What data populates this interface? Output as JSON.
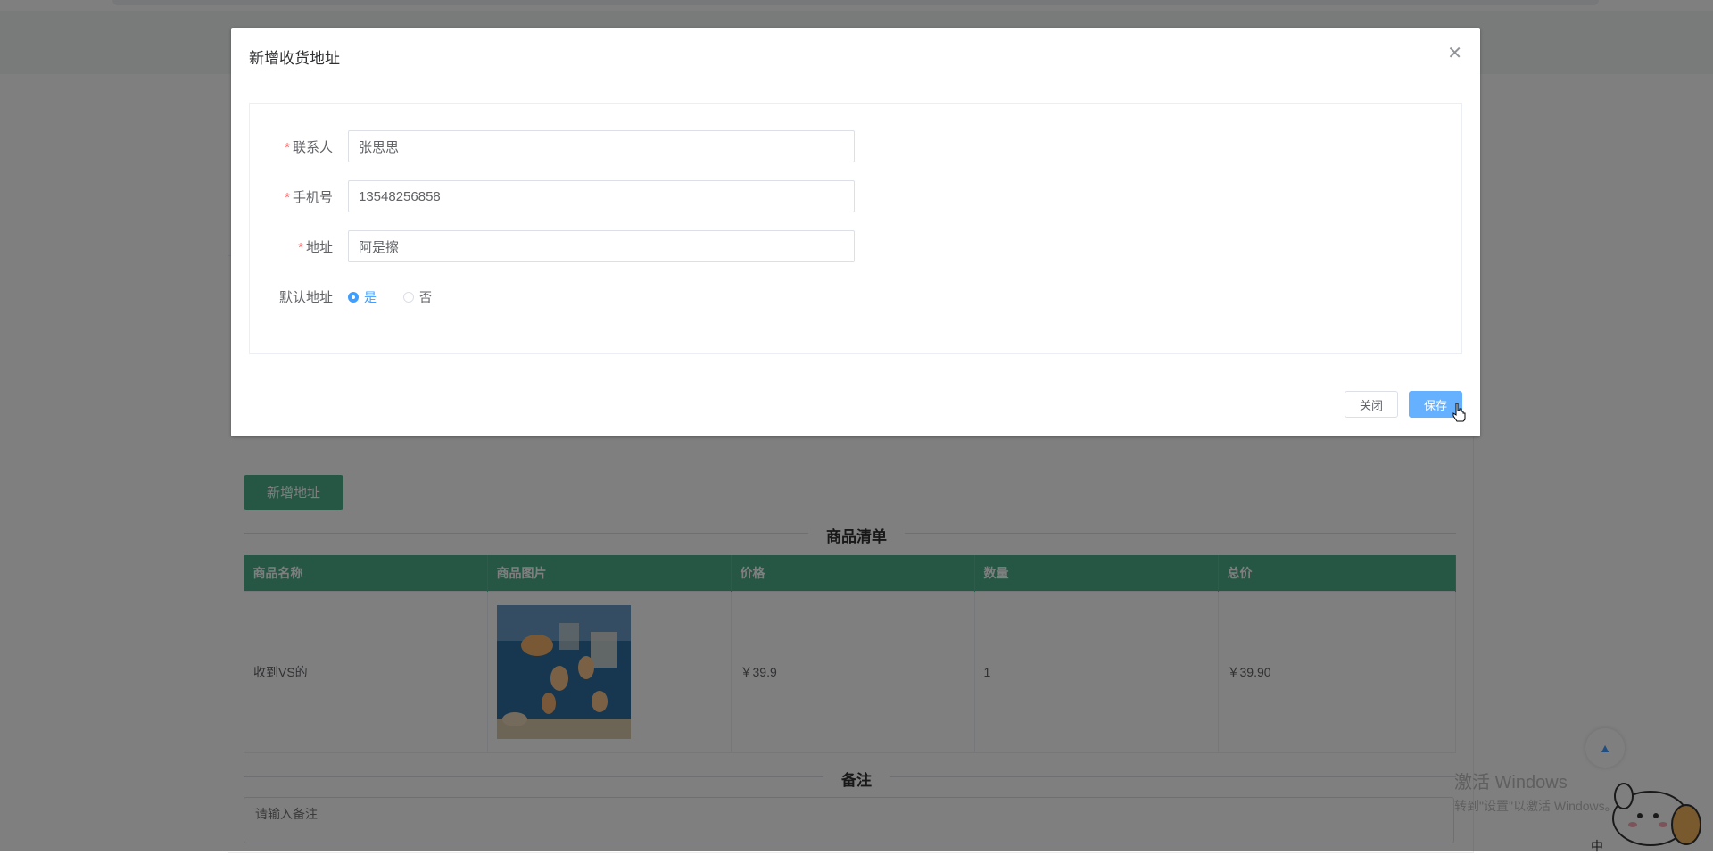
{
  "background": {
    "add_address_label": "新增地址",
    "goods_section_title": "商品清单",
    "table": {
      "headers": [
        "商品名称",
        "商品图片",
        "价格",
        "数量",
        "总价"
      ],
      "rows": [
        {
          "name": "收到VS的",
          "price": "￥39.9",
          "quantity": "1",
          "total": "￥39.90"
        }
      ]
    },
    "remark_section_title": "备注",
    "remark_placeholder": "请输入备注",
    "back_top_icon": "caret-up-icon"
  },
  "dialog": {
    "title": "新增收货地址",
    "close_icon": "close-icon",
    "fields": {
      "contact": {
        "label": "联系人",
        "value": "张思思",
        "required": true
      },
      "phone": {
        "label": "手机号",
        "value": "13548256858",
        "required": true
      },
      "address": {
        "label": "地址",
        "value": "阿是擦",
        "required": true
      },
      "default": {
        "label": "默认地址",
        "options": [
          "是",
          "否"
        ],
        "selected": "是"
      }
    },
    "buttons": {
      "close": "关闭",
      "save": "保存"
    }
  },
  "watermark": {
    "line1": "激活 Windows",
    "line2": "转到\"设置\"以激活 Windows。"
  },
  "ime_indicator": "中",
  "colors": {
    "primary": "#409eff",
    "theme_green": "#4caf8a",
    "required": "#f56c6c"
  }
}
